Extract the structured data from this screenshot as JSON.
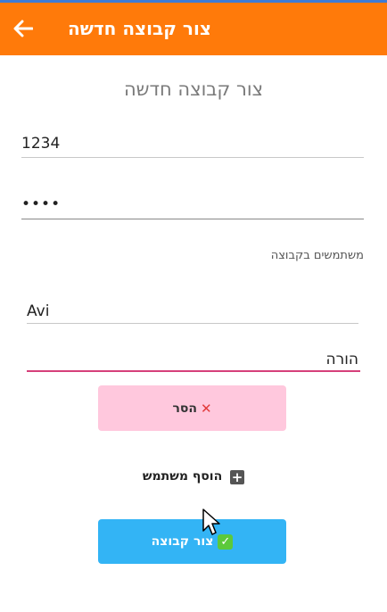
{
  "appbar": {
    "title": "צור קבוצה חדשה",
    "back_icon": "arrow-left-icon",
    "color": "#ff7a0a"
  },
  "form": {
    "heading": "צור קבוצה חדשה",
    "group_id_value": "1234",
    "password_value": "••••",
    "members_label": "משתמשים בקבוצה",
    "member_name_value": "Avi",
    "member_role_value": "הורה",
    "remove_label": "הסר",
    "add_user_label": "הוסף משתמש",
    "create_label": "צור קבוצה"
  },
  "colors": {
    "remove_bg": "#ffc8dd",
    "create_bg": "#33b4f5",
    "active_underline": "#d6407a"
  }
}
